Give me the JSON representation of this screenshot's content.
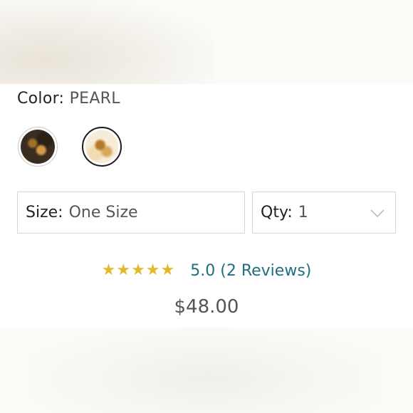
{
  "color": {
    "label": "Color:",
    "value": "PEARL",
    "swatches": [
      {
        "name": "black-variant",
        "selected": false
      },
      {
        "name": "pearl-variant",
        "selected": true
      }
    ]
  },
  "size": {
    "label": "Size:",
    "value": "One Size"
  },
  "quantity": {
    "label": "Qty:",
    "value": "1",
    "icon": "chevron-down-icon"
  },
  "rating": {
    "stars_display": "★★★★★",
    "stars_value": 5,
    "link_text": "5.0 (2 Reviews)",
    "star_color": "#e3b92b",
    "link_color": "#1f6f80"
  },
  "price": "$48.00"
}
